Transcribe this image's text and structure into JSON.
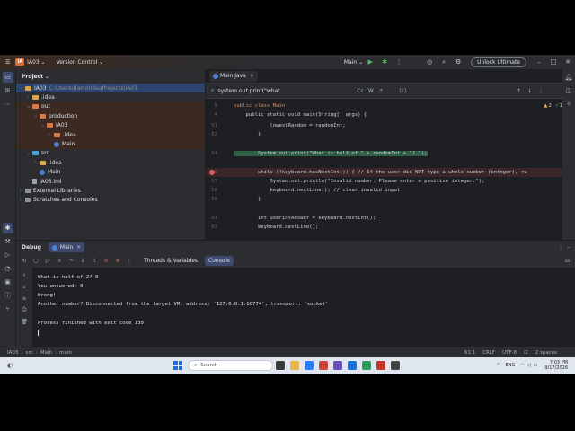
{
  "titlebar": {
    "project_badge": "IA",
    "project_name": "IA03",
    "vcs": "Version Control",
    "run_config": "Main",
    "unlock": "Unlock Ultimate"
  },
  "project_panel": {
    "title": "Project",
    "items": [
      {
        "label": "IA03",
        "path": "C:\\Users\\Barco\\IdeaProjects\\IA03"
      },
      {
        "label": ".idea"
      },
      {
        "label": "out"
      },
      {
        "label": "production"
      },
      {
        "label": "IA03"
      },
      {
        "label": ".idea"
      },
      {
        "label": "Main"
      },
      {
        "label": "src"
      },
      {
        "label": ".idea"
      },
      {
        "label": "Main"
      },
      {
        "label": "IA03.iml"
      },
      {
        "label": "External Libraries"
      },
      {
        "label": "Scratches and Consoles"
      }
    ]
  },
  "editor": {
    "tab": "Main.java",
    "find_text": "system.out.print(\"what",
    "find_opts": [
      "Cc",
      "W",
      ".*"
    ],
    "match_count": "1/1",
    "annotations": {
      "warnings": "2",
      "ok": "1"
    },
    "lines": [
      {
        "n": "9",
        "code": "public class Main"
      },
      {
        "n": "4",
        "code": "    public static void main(String[] args) {"
      },
      {
        "n": "51",
        "code": "            lowestRandom = randomInt;"
      },
      {
        "n": "52",
        "code": "        }"
      },
      {
        "n": "54",
        "code": "        System.out.print(\"What is half of \" + randomInt + \"? \");"
      },
      {
        "n": "56",
        "code": "        while (!keyboard.hasNextInt()) { // If the user did NOT type a whole number (integer), ru"
      },
      {
        "n": "57",
        "code": "            System.out.println(\"Invalid number. Please enter a positive integer.\");"
      },
      {
        "n": "58",
        "code": "            keyboard.nextLine(); // clear invalid input"
      },
      {
        "n": "59",
        "code": "        }"
      },
      {
        "n": "61",
        "code": "        int userIntAnswer = keyboard.nextInt();"
      },
      {
        "n": "62",
        "code": "        keyboard.nextLine();"
      }
    ]
  },
  "debug": {
    "title": "Debug",
    "session_tab": "Main",
    "tabs": [
      "Threads & Variables",
      "Console"
    ],
    "console_lines": [
      "What is half of 2? 0",
      "You answered: 0",
      "Wrong!",
      "Another number? Disconnected from the target VM, address: '127.0.0.1:60774', transport: 'socket'",
      "",
      "Process finished with exit code 130"
    ]
  },
  "statusbar": {
    "crumbs": [
      "IA03",
      "src",
      "Main",
      "main"
    ],
    "position": "61:1",
    "line_sep": "CRLF",
    "encoding": "UTF-8",
    "indent": "2 spaces"
  },
  "taskbar": {
    "search_placeholder": "Search",
    "lang": "ENG",
    "time": "7:03 PM",
    "date": "9/17/2026"
  }
}
